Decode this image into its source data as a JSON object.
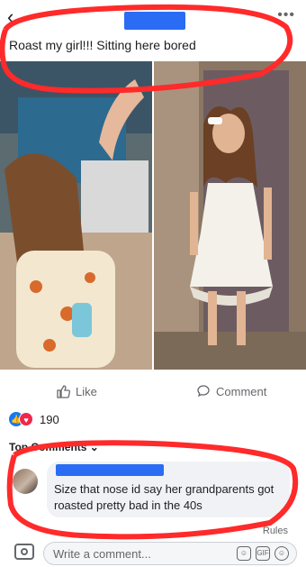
{
  "post": {
    "text": "Roast my girl!!! Sitting here bored",
    "back_icon": "chevron-left-icon",
    "more_icon": "more-icon"
  },
  "actions": {
    "like_label": "Like",
    "comment_label": "Comment",
    "reaction_count": "190"
  },
  "comments": {
    "header": "Top Comments",
    "items": [
      {
        "text": "Size that nose id say her grandparents got roasted pretty bad in the 40s"
      }
    ]
  },
  "footer": {
    "rules_label": "Rules",
    "placeholder": "Write a comment...",
    "gif_label": "GIF"
  },
  "colors": {
    "accent": "#1877f2",
    "annotation": "#ff2a2a",
    "redaction": "#2a6df4"
  }
}
